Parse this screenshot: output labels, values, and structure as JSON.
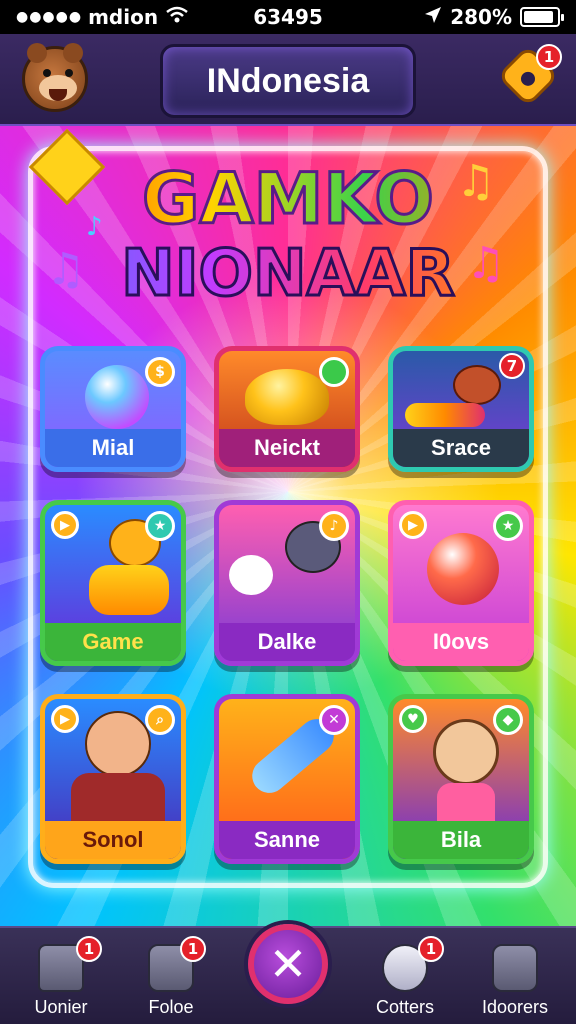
{
  "status_bar": {
    "carrier": "mdion",
    "time": "63495",
    "battery_text": "280%"
  },
  "header": {
    "title": "INdonesia",
    "settings_badge": "1"
  },
  "logo": {
    "line1": "GAMKO",
    "line2": "NIONAAR"
  },
  "cards": [
    {
      "label": "Mial",
      "badge": "",
      "color": "#4a8cff"
    },
    {
      "label": "Neickt",
      "badge": "",
      "color": "#e0306e"
    },
    {
      "label": "Srace",
      "badge": "7",
      "color": "#2fc9b0"
    },
    {
      "label": "Game",
      "badge": "",
      "color": "#46c94a"
    },
    {
      "label": "Dalke",
      "badge": "",
      "color": "#a03ad6"
    },
    {
      "label": "I0ovs",
      "badge": "",
      "color": "#ff5fb0"
    },
    {
      "label": "Sonol",
      "badge": "",
      "color": "#ffae1a"
    },
    {
      "label": "Sanne",
      "badge": "",
      "color": "#a03ad6"
    },
    {
      "label": "Bila",
      "badge": "",
      "color": "#46c94a"
    }
  ],
  "bottom_nav": {
    "items": [
      {
        "label": "Uonier",
        "badge": "1",
        "icon": "home-icon"
      },
      {
        "label": "Foloe",
        "badge": "1",
        "icon": "grid-icon"
      },
      {
        "label": "",
        "badge": "",
        "icon": "close-icon",
        "glyph": "✕"
      },
      {
        "label": "Cotters",
        "badge": "1",
        "icon": "cloud-icon"
      },
      {
        "label": "Idoorers",
        "badge": "",
        "icon": "download-icon"
      }
    ]
  }
}
